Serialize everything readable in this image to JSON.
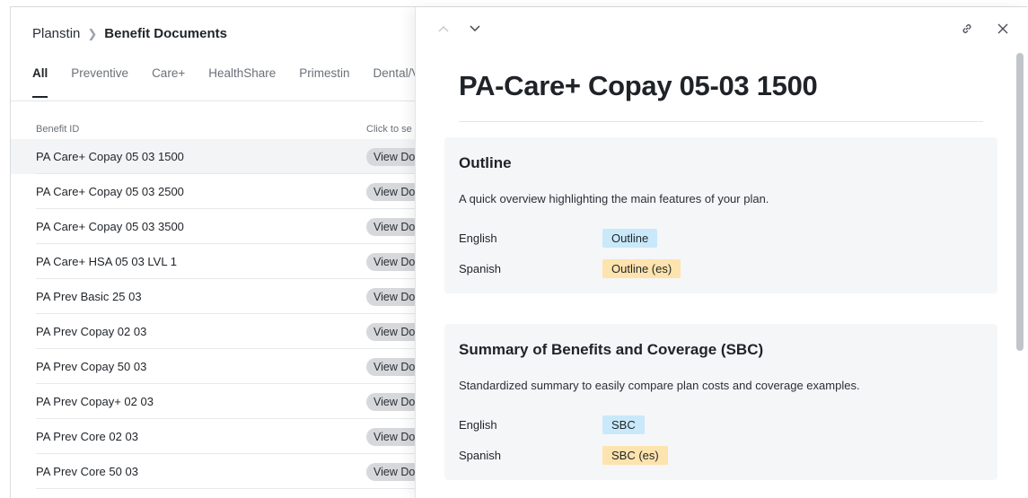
{
  "breadcrumb": {
    "root": "Planstin",
    "current": "Benefit Documents"
  },
  "tabs": [
    "All",
    "Preventive",
    "Care+",
    "HealthShare",
    "Primestin",
    "Dental/V"
  ],
  "table": {
    "headers": {
      "id": "Benefit ID",
      "action": "Click to se"
    },
    "rows": [
      {
        "id": "PA Care+ Copay 05 03 1500",
        "action": "View Do"
      },
      {
        "id": "PA Care+ Copay 05 03 2500",
        "action": "View Do"
      },
      {
        "id": "PA Care+ Copay 05 03 3500",
        "action": "View Do"
      },
      {
        "id": "PA Care+ HSA 05 03 LVL 1",
        "action": "View Do"
      },
      {
        "id": "PA Prev Basic 25 03",
        "action": "View Do"
      },
      {
        "id": "PA Prev Copay 02 03",
        "action": "View Do"
      },
      {
        "id": "PA Prev Copay 50 03",
        "action": "View Do"
      },
      {
        "id": "PA Prev Copay+ 02 03",
        "action": "View Do"
      },
      {
        "id": "PA Prev Core 02 03",
        "action": "View Do"
      },
      {
        "id": "PA Prev Core 50 03",
        "action": "View Do"
      }
    ]
  },
  "panel": {
    "title": "PA-Care+ Copay 05-03 1500",
    "sections": [
      {
        "title": "Outline",
        "description": "A quick overview highlighting the main features of your plan.",
        "links": [
          {
            "language": "English",
            "label": "Outline",
            "color": "#c9e9fb"
          },
          {
            "language": "Spanish",
            "label": "Outline (es)",
            "color": "#fde3ad"
          }
        ]
      },
      {
        "title": "Summary of Benefits and Coverage (SBC)",
        "description": "Standardized summary to easily compare plan costs and coverage examples.",
        "links": [
          {
            "language": "English",
            "label": "SBC",
            "color": "#c9e9fb"
          },
          {
            "language": "Spanish",
            "label": "SBC (es)",
            "color": "#fde3ad"
          }
        ]
      }
    ],
    "icons": [
      "chevron-up-icon",
      "chevron-down-icon",
      "link-icon",
      "close-icon"
    ]
  }
}
